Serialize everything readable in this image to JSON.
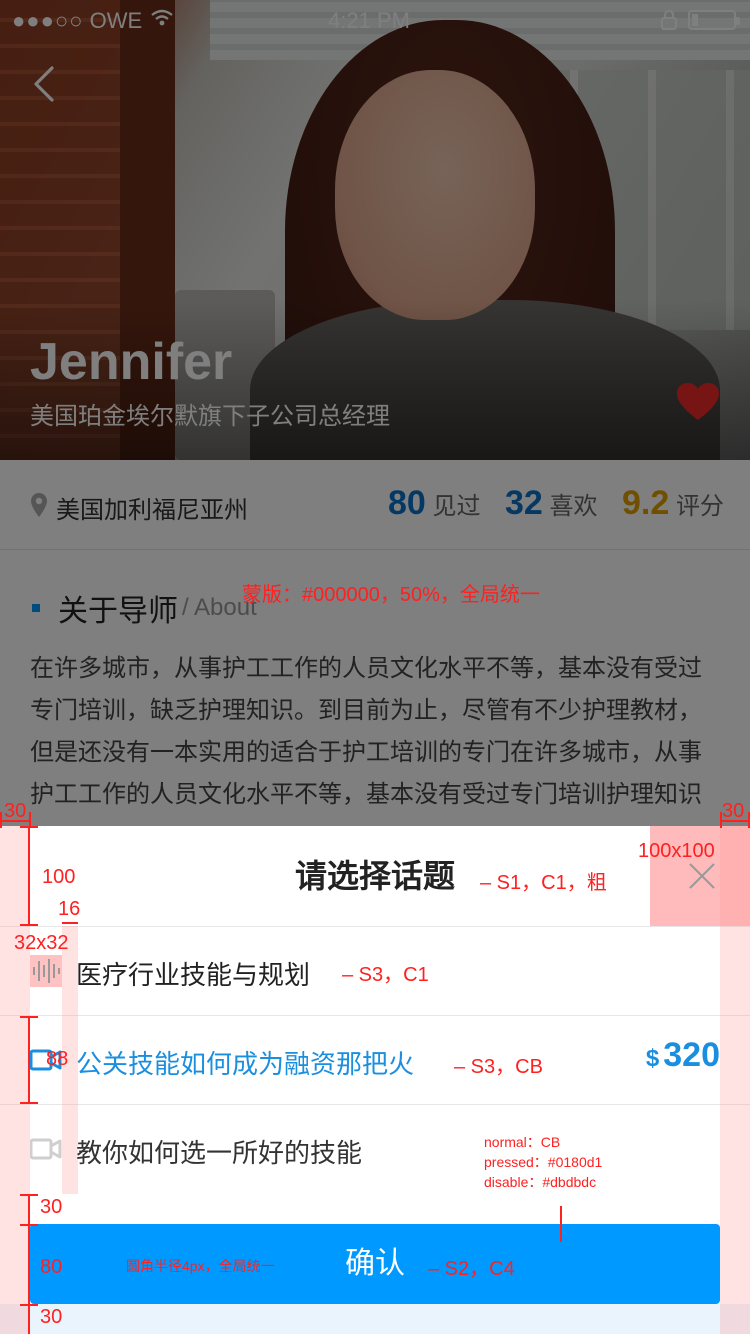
{
  "status_bar": {
    "carrier_dots": "●●●○○",
    "carrier": "OWE",
    "time": "4:21 PM"
  },
  "hero": {
    "name": "Jennifer",
    "subtitle": "美国珀金埃尔默旗下子公司总经理",
    "favorited": true
  },
  "info_bar": {
    "location": "美国加利福尼亚州",
    "stats": [
      {
        "value": "80",
        "label": "见过"
      },
      {
        "value": "32",
        "label": "喜欢"
      },
      {
        "value": "9.2",
        "label": "评分"
      }
    ]
  },
  "about": {
    "title": "关于导师",
    "title_en": "/ About",
    "text": "在许多城市，从事护工工作的人员文化水平不等，基本没有受过专门培训，缺乏护理知识。到目前为止，尽管有不少护理教材，但是还没有一本实用的适合于护工培训的专门在许多城市，从事护工工作的人员文化水平不等，基本没有受过专门培训护理知识"
  },
  "dialog": {
    "title": "请选择话题",
    "topics": [
      {
        "label": "医疗行业技能与规划",
        "state": "normal",
        "icon": "audio-wave-icon"
      },
      {
        "label": "公关技能如何成为融资那把火",
        "state": "selected",
        "icon": "video-camera-icon",
        "currency": "$",
        "price": "320"
      },
      {
        "label": "教你如何选一所好的技能",
        "state": "disabled",
        "icon": "video-camera-icon"
      }
    ],
    "confirm_label": "确认"
  },
  "annotations": {
    "mask_note": "蒙版：#000000，50%，全局统一",
    "title_spec": "– S1，C1，粗",
    "close_size": "100x100",
    "row1_spec": "– S3，C1",
    "row2_spec": "– S3，CB",
    "confirm_spec": "– S2，C4",
    "radius_note": "圆角半径4px，全局统一",
    "state_normal": "normal：CB",
    "state_pressed": "pressed：#0180d1",
    "state_disable": "disable：#dbdbdc",
    "margin_left": "30",
    "margin_right": "30",
    "title_height": "100",
    "icon_gap": "16",
    "icon_size": "32x32",
    "row_height": "88",
    "btn_top_gap": "30",
    "btn_height": "80",
    "btn_bottom_gap": "30"
  },
  "colors": {
    "primary": "#0099ff",
    "primary_text": "#1a8fe0",
    "rating": "#e0a100",
    "annotation": "#ff2020",
    "mask": "#000000"
  }
}
